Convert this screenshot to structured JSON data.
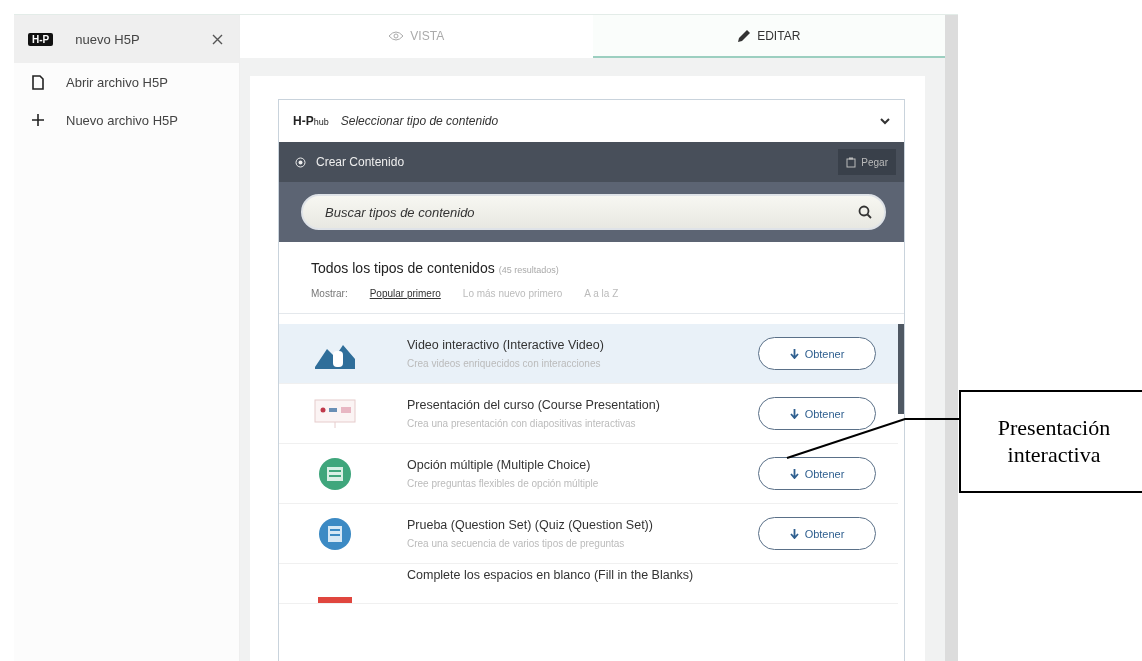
{
  "sidebar": {
    "items": [
      {
        "kind": "tab",
        "logo": "H-P",
        "label": "nuevo H5P",
        "selected": true
      },
      {
        "kind": "open",
        "label": "Abrir archivo H5P",
        "selected": false
      },
      {
        "kind": "new",
        "label": "Nuevo archivo H5P",
        "selected": false
      }
    ]
  },
  "tabs": [
    {
      "label": "VISTA",
      "kind": "view",
      "selected": false
    },
    {
      "label": "EDITAR",
      "kind": "edit",
      "selected": true
    }
  ],
  "hub": {
    "logo": "H-P",
    "logo_suffix": "hub",
    "title": "Seleccionar tipo de contenido",
    "create_label": "Crear Contenido",
    "paste_label": "Pegar",
    "search": {
      "placeholder": "Buscar tipos de contenido"
    },
    "heading": "Todos los tipos de contenidos",
    "count": "(45 resultados)",
    "sort_label": "Mostrar:",
    "sort_options": [
      {
        "label": "Popular primero",
        "selected": true
      },
      {
        "label": "Lo más nuevo primero",
        "selected": false
      },
      {
        "label": "A a la Z",
        "selected": false
      }
    ],
    "items": [
      {
        "title": "Video interactivo (Interactive Video)",
        "description": "Crea videos enriquecidos con interacciones",
        "button": "Obtener",
        "selected": true
      },
      {
        "title": "Presentación del curso (Course Presentation)",
        "description": "Crea una presentación con diapositivas interactivas",
        "button": "Obtener",
        "selected": false
      },
      {
        "title": "Opción múltiple (Multiple Choice)",
        "description": "Cree preguntas flexibles de opción múltiple",
        "button": "Obtener",
        "selected": false
      },
      {
        "title": "Prueba (Question Set) (Quiz (Question Set))",
        "description": "Crea una secuencia de varios tipos de preguntas",
        "button": "Obtener",
        "selected": false
      },
      {
        "title": "Complete los espacios en blanco (Fill in the Blanks)",
        "selected": false
      }
    ]
  },
  "callout": {
    "text": "Presentación interactiva"
  }
}
